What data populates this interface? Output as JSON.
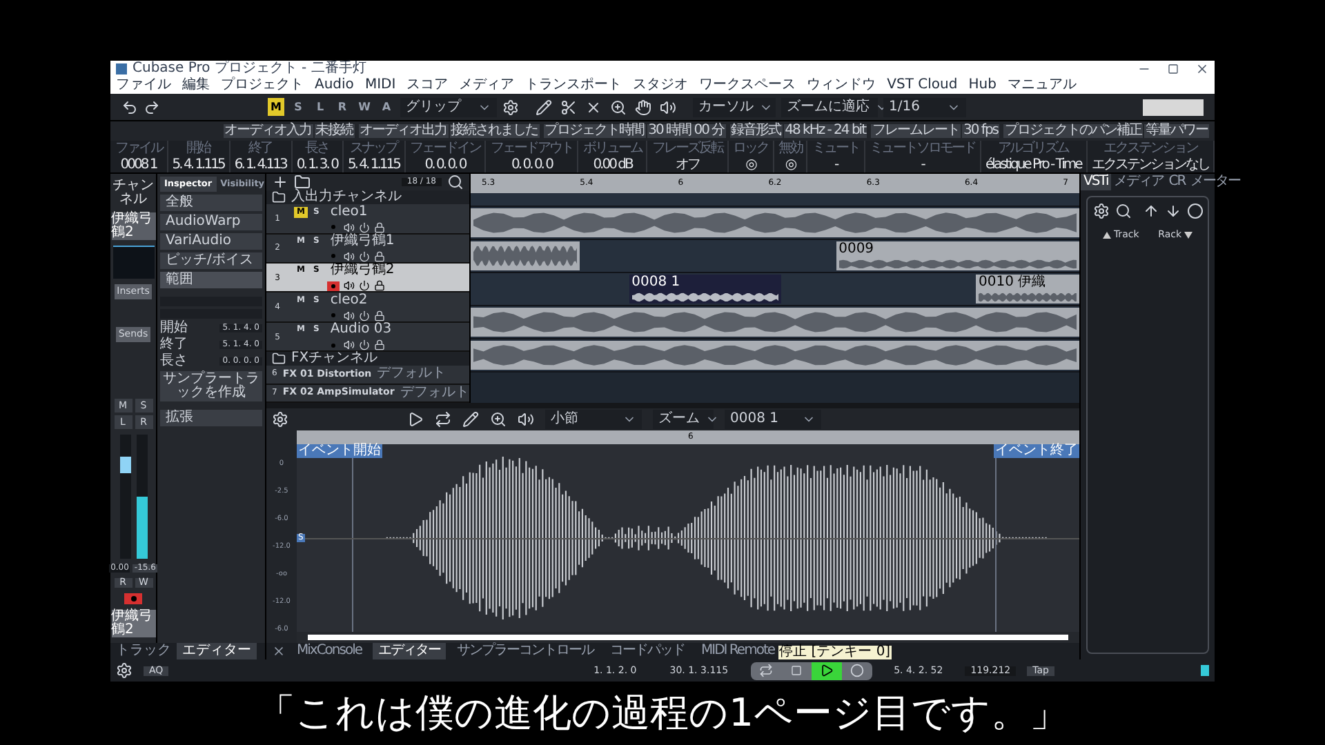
{
  "window": {
    "title": "Cubase Pro プロジェクト - 二番手灯"
  },
  "menu": [
    "ファイル",
    "編集",
    "プロジェクト",
    "Audio",
    "MIDI",
    "スコア",
    "メディア",
    "トランスポート",
    "スタジオ",
    "ワークスペース",
    "ウィンドウ",
    "VST Cloud",
    "Hub",
    "マニュアル"
  ],
  "toolbar": {
    "modes": [
      {
        "label": "M",
        "selected": true
      },
      {
        "label": "S",
        "selected": false
      },
      {
        "label": "L",
        "selected": false
      },
      {
        "label": "R",
        "selected": false
      },
      {
        "label": "W",
        "selected": false
      },
      {
        "label": "A",
        "selected": false
      }
    ],
    "mode_dropdown": "グリップ",
    "cursor_dropdown": "カーソル",
    "zoom_dropdown": "ズームに適応",
    "quantize_dropdown": "1/16"
  },
  "status_row": [
    {
      "label": "オーディオ入力",
      "value": "未接続"
    },
    {
      "label": "オーディオ出力",
      "value": "接続されました"
    },
    {
      "label": "プロジェクト時間",
      "value": "30 時間 00 分"
    },
    {
      "label": "録音形式",
      "value": "48 kHz - 24 bit"
    },
    {
      "label": "フレームレート",
      "value": "30 fps"
    },
    {
      "label": "プロジェクトのパン補正",
      "value": "等量パワー"
    }
  ],
  "info_line": [
    {
      "label": "ファイル",
      "value": "0008 1"
    },
    {
      "label": "開始",
      "value": "5. 4. 1.115"
    },
    {
      "label": "終了",
      "value": "6. 1. 4.113"
    },
    {
      "label": "長さ",
      "value": "0. 1. 3. 0"
    },
    {
      "label": "スナップ",
      "value": "5. 4. 1.115"
    },
    {
      "label": "フェードイン",
      "value": "0. 0. 0. 0"
    },
    {
      "label": "フェードアウト",
      "value": "0. 0. 0. 0"
    },
    {
      "label": "ボリューム",
      "value": "0.00 dB"
    },
    {
      "label": "フレーズ反転",
      "value": "オフ"
    },
    {
      "label": "ロック",
      "value": "◎"
    },
    {
      "label": "無効",
      "value": "◎"
    },
    {
      "label": "ミュート",
      "value": "-"
    },
    {
      "label": "ミュートソロモード",
      "value": "-"
    },
    {
      "label": "アルゴリズム",
      "value": "élastique Pro - Time"
    },
    {
      "label": "エクステンション",
      "value": "エクステンションなし"
    }
  ],
  "channel_strip": {
    "tab": "チャンネル",
    "name": "伊織弓鶴2",
    "inserts": "Inserts",
    "sends": "Sends",
    "buttons": [
      "M",
      "S",
      "L",
      "R"
    ],
    "volume": "0.00",
    "peak": "-15.6",
    "fader": {
      "level": 0.82
    },
    "meter": {
      "level": 0.5
    },
    "read": "R",
    "write": "W",
    "record": true,
    "bottom_name": "伊織弓鶴2"
  },
  "inspector": {
    "tabs": [
      {
        "label": "Inspector",
        "selected": true
      },
      {
        "label": "Visibility",
        "selected": false
      }
    ],
    "sections": [
      {
        "label": "全般",
        "expanded": false
      },
      {
        "label": "AudioWarp",
        "expanded": false
      },
      {
        "label": "VariAudio",
        "expanded": false
      },
      {
        "label": "ピッチ/ボイス",
        "expanded": false
      },
      {
        "label": "範囲",
        "expanded": true
      },
      {
        "label": "拡張",
        "expanded": false
      }
    ],
    "fields": [
      {
        "label": "開始",
        "value": "5. 1. 4. 0"
      },
      {
        "label": "終了",
        "value": "5. 1. 4. 0"
      },
      {
        "label": "長さ",
        "value": "0. 0. 0. 0"
      }
    ],
    "button": "サンプラートラックを作成"
  },
  "tracks": {
    "header": "入出力チャンネル",
    "counter": "18 / 18",
    "items": [
      {
        "number": "1",
        "mute_label": "M",
        "solo_label": "S",
        "name": "cleo1",
        "muted": true,
        "selected": false,
        "record": false,
        "events": [
          {
            "selected": false
          }
        ]
      },
      {
        "number": "2",
        "mute_label": "M",
        "solo_label": "S",
        "name": "伊織弓鶴1",
        "muted": false,
        "selected": false,
        "record": false,
        "events": [
          {
            "selected": false
          },
          {
            "label": "0009",
            "selected": false
          }
        ]
      },
      {
        "number": "3",
        "mute_label": "M",
        "solo_label": "S",
        "name": "伊織弓鶴2",
        "muted": false,
        "selected": true,
        "record": true,
        "events": [
          {
            "label": "0008 1",
            "selected": true
          },
          {
            "label": "0010 伊織",
            "selected": false
          }
        ]
      },
      {
        "number": "4",
        "mute_label": "M",
        "solo_label": "S",
        "name": "cleo2",
        "muted": false,
        "selected": false,
        "record": false,
        "events": [
          {
            "selected": false
          }
        ]
      },
      {
        "number": "5",
        "mute_label": "M",
        "solo_label": "S",
        "name": "Audio 03",
        "muted": false,
        "selected": false,
        "record": false,
        "events": [
          {
            "selected": false
          }
        ]
      }
    ],
    "fx_folder": "FXチャンネル",
    "fx": [
      {
        "number": "6",
        "name": "FX 01 Distortion",
        "preset": "デフォルト"
      },
      {
        "number": "7",
        "name": "FX 02 AmpSimulator",
        "preset": "デフォルト"
      }
    ]
  },
  "arrange": {
    "ruler": [
      "5.3",
      "5.4",
      "6",
      "6.2",
      "6.3",
      "6.4",
      "7"
    ]
  },
  "right_panel": {
    "tabs": [
      {
        "label": "VSTi",
        "selected": true
      },
      {
        "label": "メディア",
        "selected": false
      },
      {
        "label": "CR",
        "selected": false
      },
      {
        "label": "メーター",
        "selected": false
      }
    ],
    "track": "Track",
    "rack": "Rack"
  },
  "editor": {
    "grid_dropdown": "小節",
    "zoom": "ズーム",
    "event_dropdown": "0008 1",
    "ruler": "6",
    "event_start": "イベント開始",
    "event_end": "イベント終了",
    "center_marker": "S",
    "scale": [
      "0",
      "-2.5",
      "-6.0",
      "-12.0",
      "-oo",
      "-12.0",
      "-6.0"
    ]
  },
  "left_tabs": [
    {
      "label": "トラック",
      "selected": false
    },
    {
      "label": "エディター",
      "selected": true
    }
  ],
  "lower_tabs": [
    {
      "label": "MixConsole",
      "selected": false
    },
    {
      "label": "エディター",
      "selected": true
    },
    {
      "label": "サンプラーコントロール",
      "selected": false
    },
    {
      "label": "コードパッド",
      "selected": false
    },
    {
      "label": "MIDI Remote",
      "selected": false
    }
  ],
  "transport": {
    "aq": "AQ",
    "left_locator": "1. 1. 2. 0",
    "right_locator": "30. 1. 3.115",
    "tooltip": "停止 [テンキー 0]",
    "playing": true,
    "position": "5. 4. 2. 52",
    "tempo": "119.212",
    "tap": "Tap"
  },
  "subtitle": "「これは僕の進化の過程の1ページ目です。」"
}
